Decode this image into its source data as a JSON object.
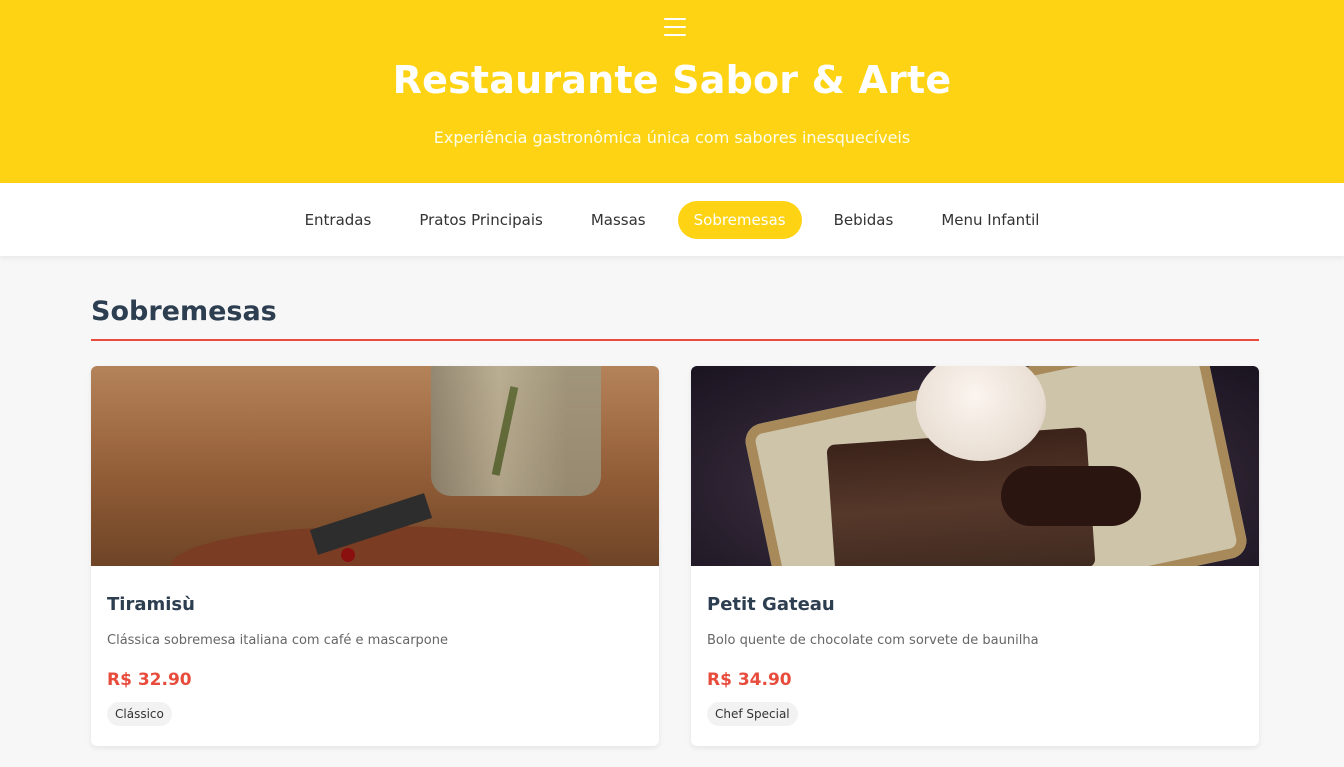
{
  "hero": {
    "title": "Restaurante Sabor & Arte",
    "subtitle": "Experiência gastronômica única com sabores inesquecíveis",
    "menu_icon": "hamburger-menu-icon",
    "background_color": "#fed314"
  },
  "nav": {
    "tabs": [
      {
        "label": "Entradas"
      },
      {
        "label": "Pratos Principais"
      },
      {
        "label": "Massas"
      },
      {
        "label": "Sobremesas",
        "active": true
      },
      {
        "label": "Bebidas"
      },
      {
        "label": "Menu Infantil"
      }
    ]
  },
  "section": {
    "title": "Sobremesas",
    "accent_color": "#e74c3c"
  },
  "items": [
    {
      "name": "Tiramisù",
      "description": "Clássica sobremesa italiana com café e mascarpone",
      "price": "R$ 32.90",
      "tag": "Clássico"
    },
    {
      "name": "Petit Gateau",
      "description": "Bolo quente de chocolate com sorvete de baunilha",
      "price": "R$ 34.90",
      "tag": "Chef Special"
    }
  ]
}
